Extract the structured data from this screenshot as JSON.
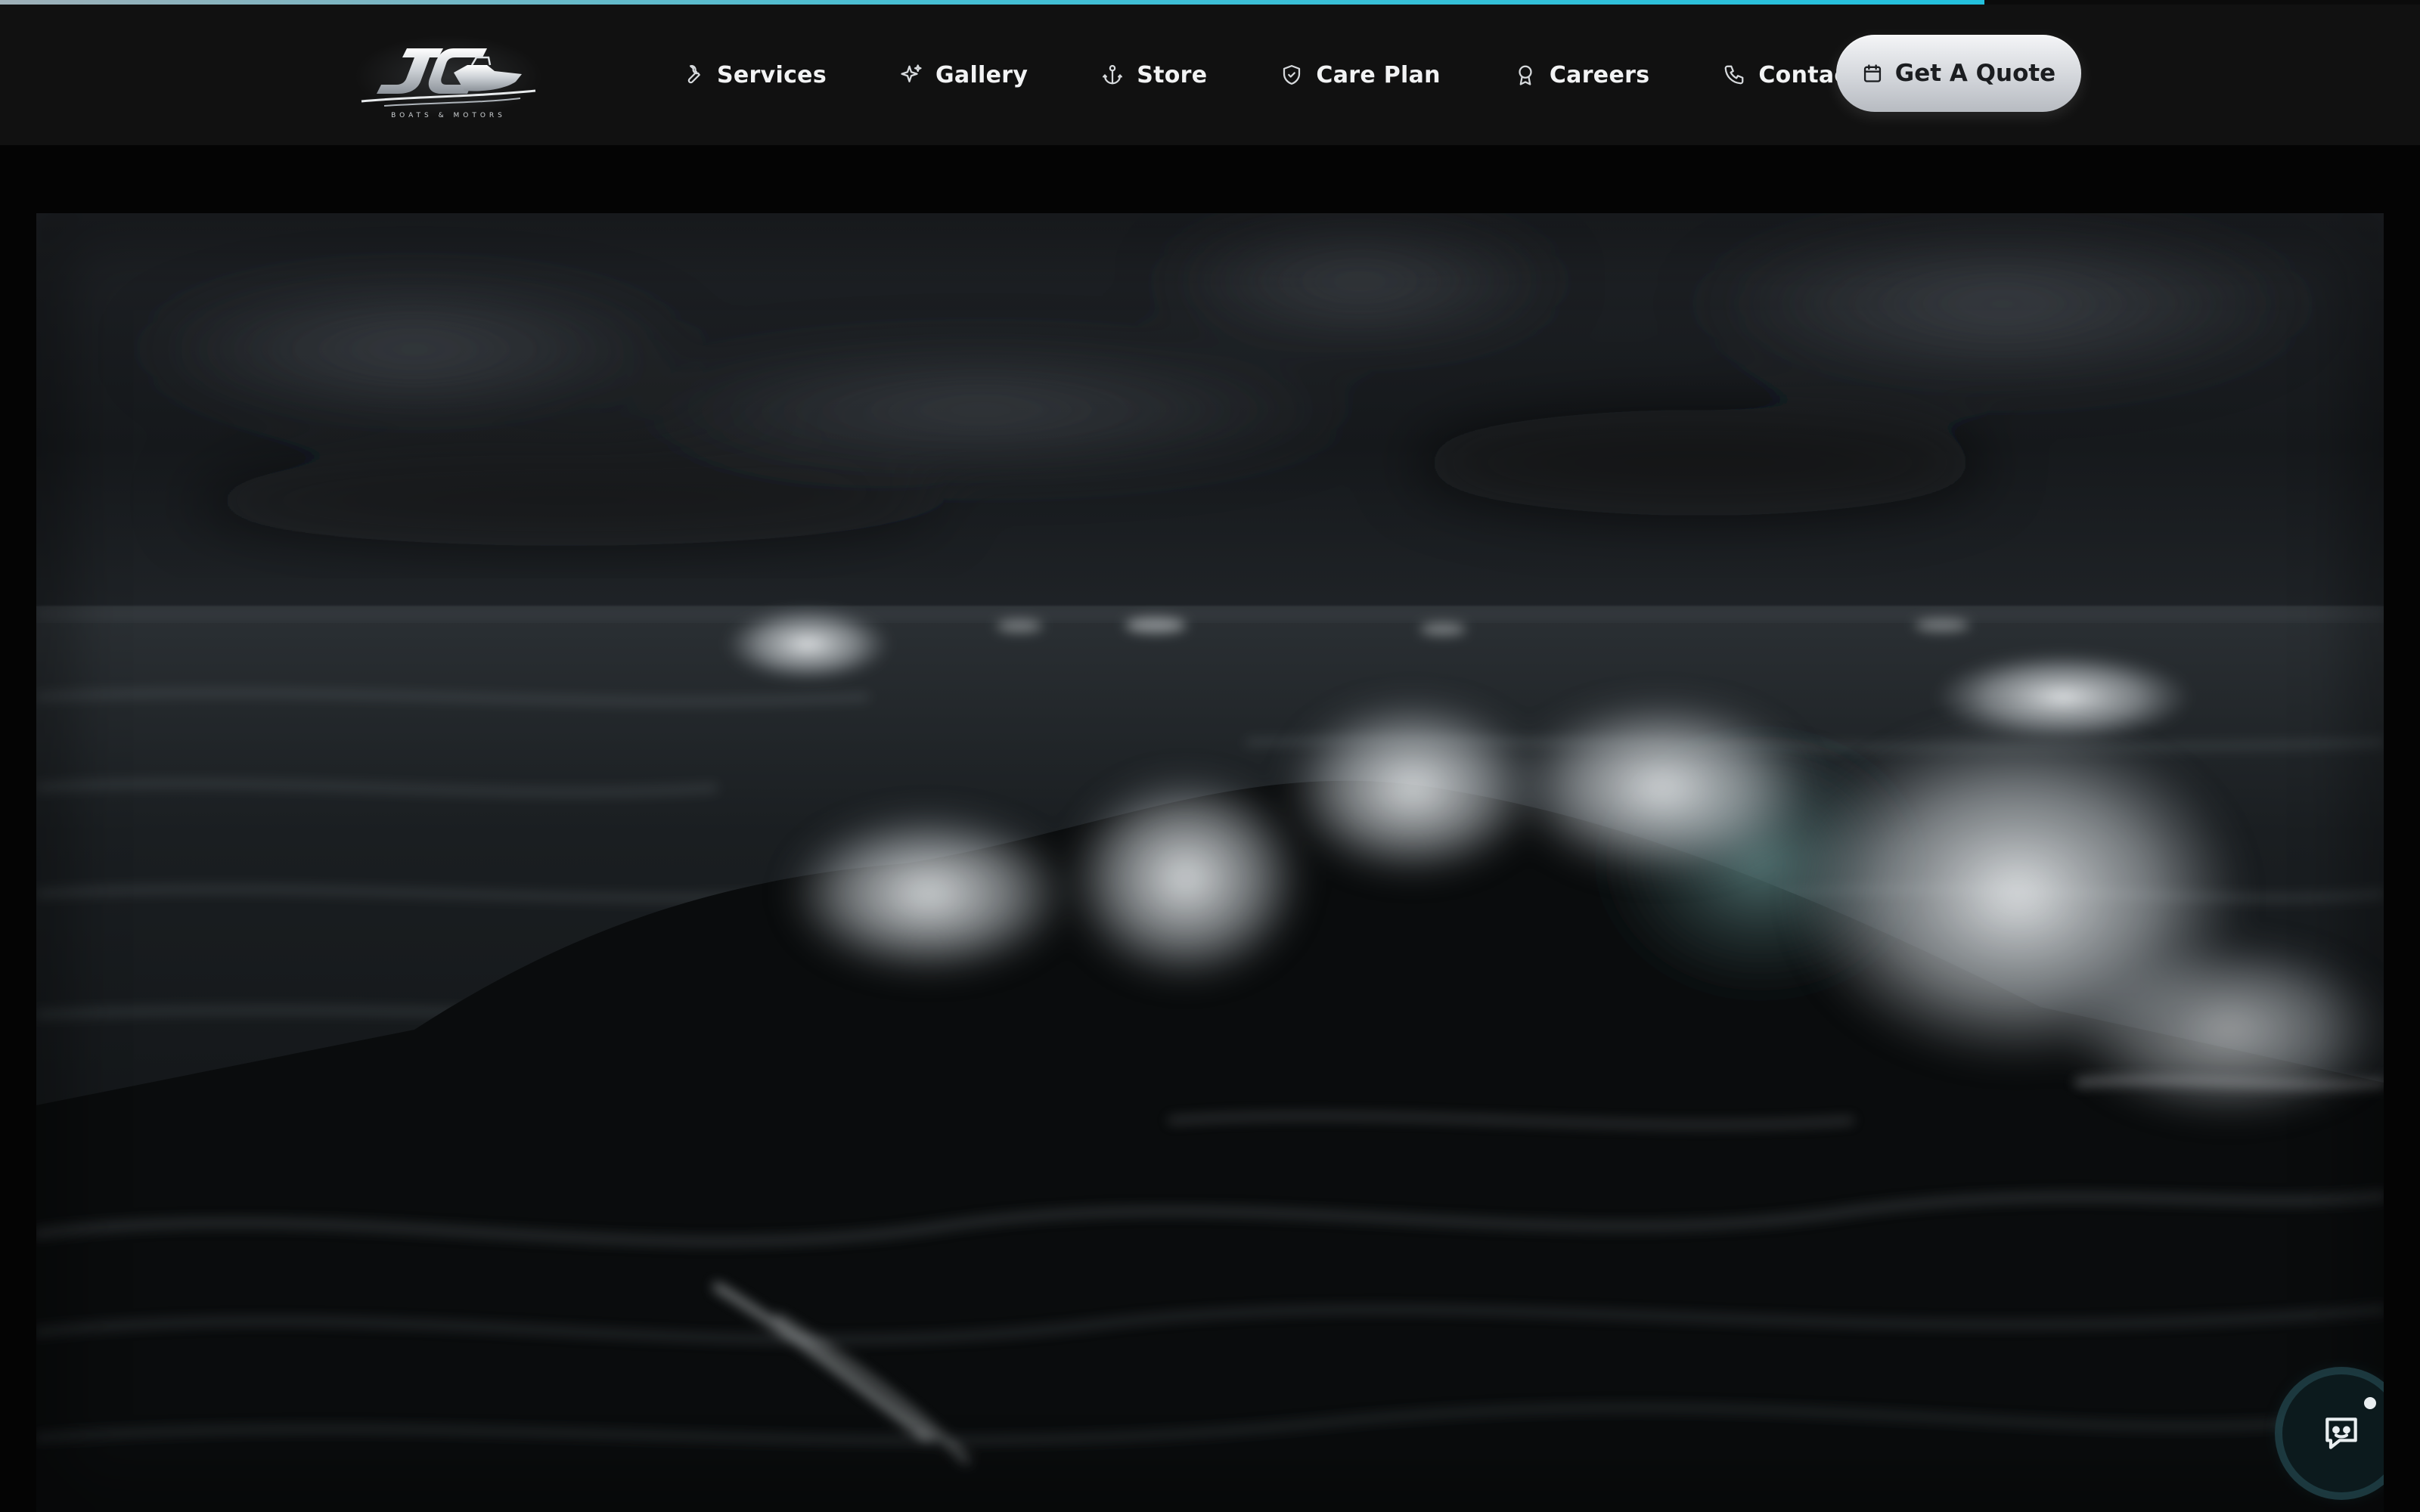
{
  "progress": {
    "percent": 82
  },
  "header": {
    "logo": {
      "name": "jc-logo",
      "tagline": "BOATS & MOTORS"
    },
    "nav": [
      {
        "label": "Services",
        "icon": "wrench-icon"
      },
      {
        "label": "Gallery",
        "icon": "sparkle-icon"
      },
      {
        "label": "Store",
        "icon": "anchor-icon"
      },
      {
        "label": "Care Plan",
        "icon": "shield-icon"
      },
      {
        "label": "Careers",
        "icon": "award-icon"
      },
      {
        "label": "Contact",
        "icon": "phone-icon"
      }
    ],
    "cta": {
      "label": "Get A Quote",
      "icon": "calendar-icon"
    }
  },
  "hero": {
    "image": "stormy-ocean-waves"
  },
  "chat": {
    "icon": "chat-bot-icon",
    "status": "online"
  },
  "colors": {
    "background": "#040404",
    "header": "#111111",
    "accent": "#23c0dd",
    "cta_bg": "#d3d6db",
    "nav_text": "#f2f3f4"
  }
}
